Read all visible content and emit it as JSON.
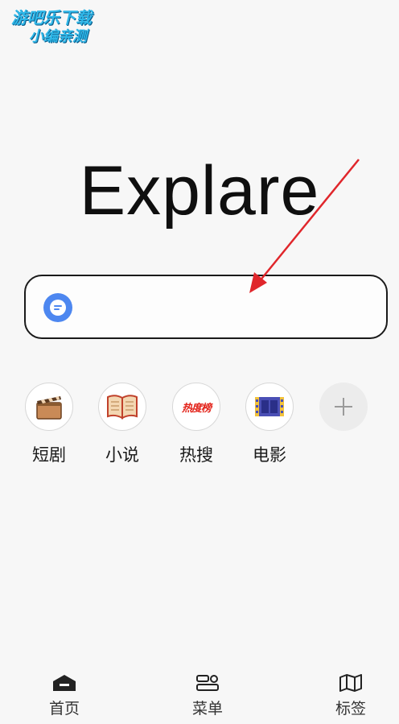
{
  "watermark": {
    "line1": "游吧乐下载",
    "line2": "小编亲测"
  },
  "logo": {
    "text": "Explare"
  },
  "search": {
    "placeholder": "",
    "engine_icon": "chat-bubble-icon",
    "engine_color": "#4d87f0"
  },
  "shortcuts": [
    {
      "label": "短剧",
      "icon": "clapperboard-icon"
    },
    {
      "label": "小说",
      "icon": "open-book-icon"
    },
    {
      "label": "热搜",
      "icon": "hot-list-icon",
      "icon_text": "热度榜"
    },
    {
      "label": "电影",
      "icon": "film-strip-icon"
    },
    {
      "label": "",
      "icon": "add-icon"
    }
  ],
  "nav": {
    "home": {
      "label": "首页",
      "icon": "home-icon"
    },
    "menu": {
      "label": "菜单",
      "icon": "menu-icon"
    },
    "bookmarks": {
      "label": "标签",
      "icon": "map-icon"
    }
  },
  "colors": {
    "arrow": "#e0262b",
    "accent": "#4d87f0",
    "background": "#f7f7f7"
  }
}
